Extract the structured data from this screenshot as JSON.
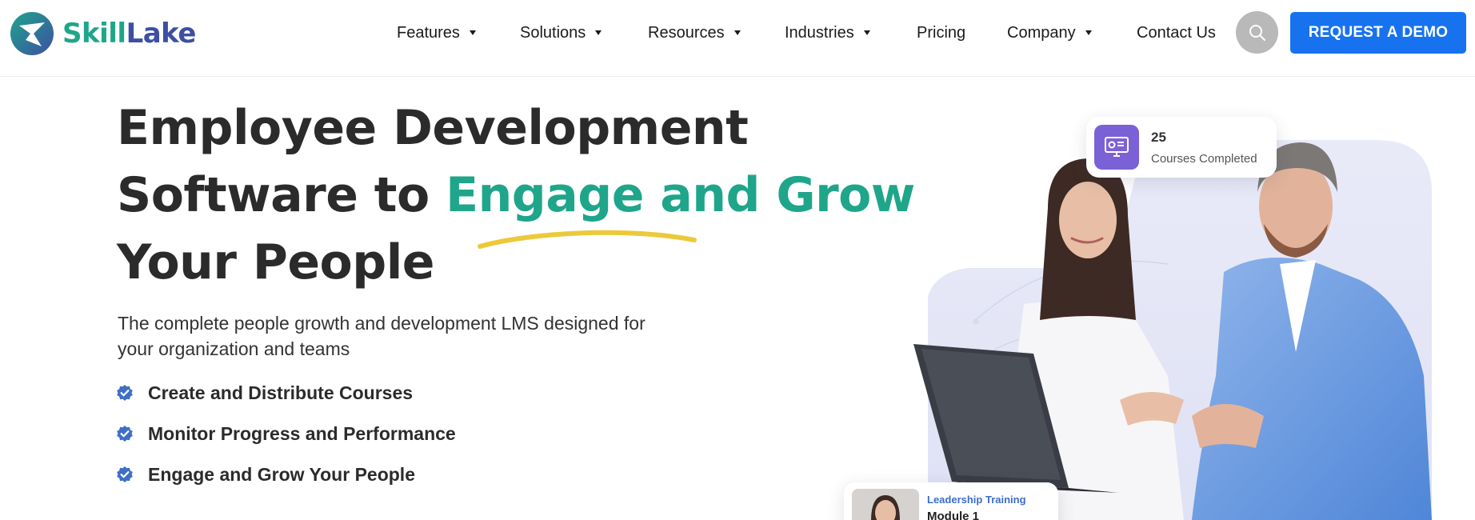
{
  "brand": {
    "name_part1": "Skill",
    "name_part2": "Lake",
    "colors": {
      "teal": "#1fa58a",
      "navy": "#3d4fa3",
      "accent_blue": "#1772f0",
      "underline_yellow": "#ecc93a"
    }
  },
  "nav": {
    "items": [
      {
        "label": "Features",
        "has_dropdown": true
      },
      {
        "label": "Solutions",
        "has_dropdown": true
      },
      {
        "label": "Resources",
        "has_dropdown": true
      },
      {
        "label": "Industries",
        "has_dropdown": true
      },
      {
        "label": "Pricing",
        "has_dropdown": false
      },
      {
        "label": "Company",
        "has_dropdown": true
      },
      {
        "label": "Contact Us",
        "has_dropdown": false
      }
    ],
    "search_icon": "search-icon",
    "cta_label": "REQUEST A DEMO"
  },
  "hero": {
    "title_line1": "Employee Development",
    "title_line2_prefix": "Software to ",
    "title_line2_accent": "Engage and Grow",
    "title_line3": "Your People",
    "subtitle_line1": "The complete people growth and development LMS designed for",
    "subtitle_line2": "your organization and teams",
    "features": [
      "Create and Distribute Courses",
      "Monitor Progress and Performance",
      "Engage and Grow Your People"
    ]
  },
  "illustration": {
    "stat_card": {
      "number": "25",
      "label": "Courses Completed",
      "icon": "monitor-icon"
    },
    "module_card": {
      "subtitle": "Leadership Training",
      "title": "Module 1"
    }
  }
}
